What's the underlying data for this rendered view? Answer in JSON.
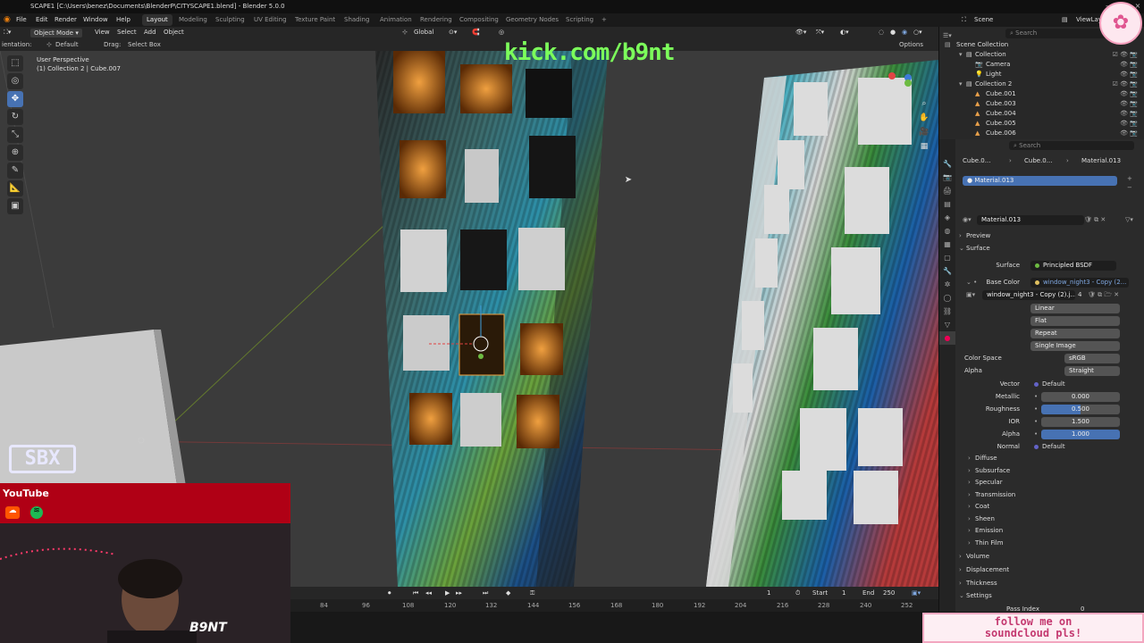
{
  "window": {
    "title": "SCAPE1 [C:\\Users\\benez\\Documents\\BlenderP\\CITYSCAPE1.blend] - Blender 5.0.0"
  },
  "menubar": {
    "menus": [
      "File",
      "Edit",
      "Render",
      "Window",
      "Help"
    ],
    "workspaces": [
      "Layout",
      "Modeling",
      "Sculpting",
      "UV Editing",
      "Texture Paint",
      "Shading",
      "Animation",
      "Rendering",
      "Compositing",
      "Geometry Nodes",
      "Scripting"
    ],
    "active_workspace": "Layout",
    "add_tab": "+",
    "scene": "Scene",
    "view_layer": "ViewLayer"
  },
  "viewport_header": {
    "mode": "Object Mode",
    "menus": [
      "View",
      "Select",
      "Add",
      "Object"
    ],
    "transform": "Global",
    "options": "Options"
  },
  "tool_header": {
    "orientation_label": "ientation:",
    "orientation_value": "Default",
    "drag_label": "Drag:",
    "drag_value": "Select Box"
  },
  "viewport": {
    "perspective": "User Perspective",
    "collection_info": "(1) Collection 2 | Cube.007"
  },
  "overlays": {
    "kick_url": "kick.com/b9nt",
    "sbx_logo": "SBX",
    "youtube": "YouTube",
    "webcam_tag": "B9NT",
    "soundcloud_line1": "follow me on",
    "soundcloud_line2": "soundcloud pls!"
  },
  "outliner": {
    "header": "Scene Collection",
    "search_placeholder": "Search",
    "rows": [
      {
        "label": "Collection",
        "indent": 1
      },
      {
        "label": "Camera",
        "indent": 2
      },
      {
        "label": "Light",
        "indent": 2
      },
      {
        "label": "Collection 2",
        "indent": 1
      },
      {
        "label": "Cube.001",
        "indent": 2
      },
      {
        "label": "Cube.003",
        "indent": 2
      },
      {
        "label": "Cube.004",
        "indent": 2
      },
      {
        "label": "Cube.005",
        "indent": 2
      },
      {
        "label": "Cube.006",
        "indent": 2
      }
    ]
  },
  "properties": {
    "search_placeholder": "Search",
    "breadcrumb": [
      "Cube.0...",
      "Cube.0...",
      "Material.013"
    ],
    "material_slot": "Material.013",
    "material_name": "Material.013",
    "sections": {
      "preview": "Preview",
      "surface": "Surface"
    },
    "surface_label": "Surface",
    "surface_value": "Principled BSDF",
    "base_color_label": "Base Color",
    "base_color_value": "window_night3 - Copy (2...",
    "image_name": "window_night3 - Copy (2).j...",
    "image_users": "4",
    "interpolation": "Linear",
    "projection": "Flat",
    "extension": "Repeat",
    "source": "Single Image",
    "color_space_label": "Color Space",
    "color_space_value": "sRGB",
    "alpha_mode_label": "Alpha",
    "alpha_mode_value": "Straight",
    "vector_label": "Vector",
    "vector_value": "Default",
    "metallic_label": "Metallic",
    "metallic_value": "0.000",
    "roughness_label": "Roughness",
    "roughness_value": "0.500",
    "ior_label": "IOR",
    "ior_value": "1.500",
    "alpha_label": "Alpha",
    "alpha_value": "1.000",
    "normal_label": "Normal",
    "normal_value": "Default",
    "subpanels": [
      "Diffuse",
      "Subsurface",
      "Specular",
      "Transmission",
      "Coat",
      "Sheen",
      "Emission",
      "Thin Film"
    ],
    "lower_sections": [
      "Volume",
      "Displacement",
      "Thickness",
      "Settings"
    ],
    "pass_index_label": "Pass Index",
    "pass_index_value": "0"
  },
  "timeline": {
    "current_frame": "1",
    "start_label": "Start",
    "start_value": "1",
    "end_label": "End",
    "end_value": "250",
    "ruler": [
      "84",
      "96",
      "108",
      "120",
      "132",
      "144",
      "156",
      "168",
      "180",
      "192",
      "204",
      "216",
      "228",
      "240",
      "252"
    ]
  },
  "colors": {
    "accent_blue": "#4772b3",
    "kick_green": "#7cff5b",
    "youtube_red": "#b00015",
    "soundcloud_pink": "#c43970"
  }
}
